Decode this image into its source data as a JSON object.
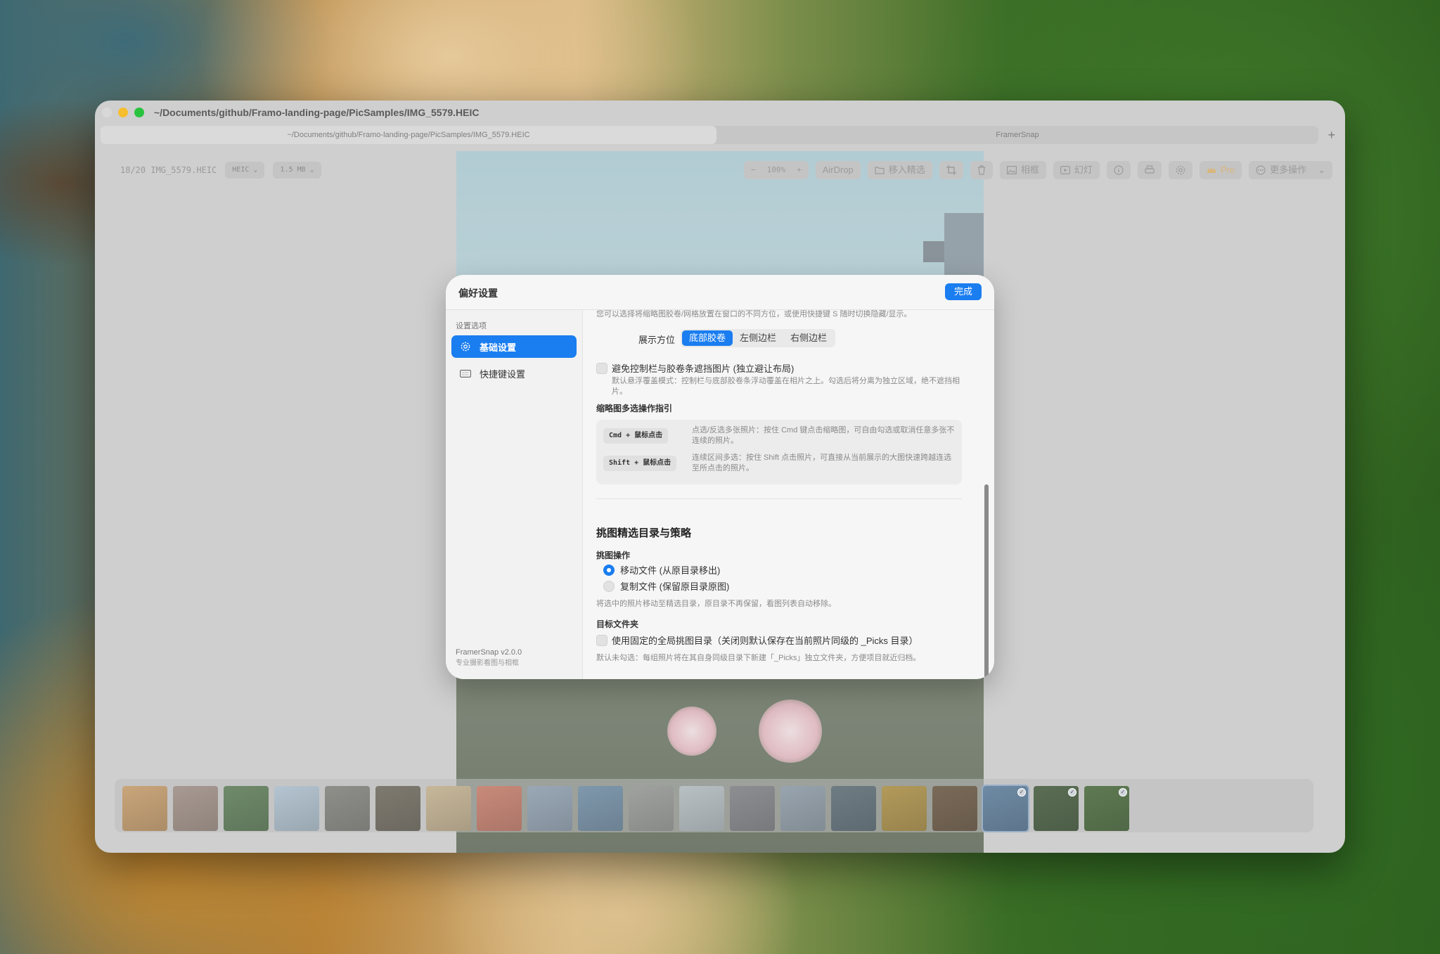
{
  "window": {
    "title": "~/Documents/github/Framo-landing-page/PicSamples/IMG_5579.HEIC",
    "tabs": [
      {
        "label": "~/Documents/github/Framo-landing-page/PicSamples/IMG_5579.HEIC",
        "active": true
      },
      {
        "label": "FramerSnap",
        "active": false
      }
    ],
    "new_tab_label": "+"
  },
  "toolbar": {
    "file_info": "18/20 IMG_5579.HEIC",
    "format": "HEIC",
    "file_size": "1.5 MB",
    "zoom_out": "−",
    "zoom_level": "100%",
    "zoom_in": "+",
    "airdrop": "AirDrop",
    "move_to_picks": "移入精选",
    "frame": "相框",
    "slideshow": "幻灯",
    "pro": "Pro",
    "more_actions": "更多操作"
  },
  "preferences": {
    "title": "偏好设置",
    "done_label": "完成",
    "sidebar": {
      "heading": "设置选项",
      "items": [
        {
          "label": "基础设置",
          "icon": "gear-icon",
          "active": true
        },
        {
          "label": "快捷键设置",
          "icon": "keyboard-icon",
          "active": false
        }
      ],
      "app_version": "FramerSnap v2.0.0",
      "app_tagline": "专业摄影看图与相框"
    },
    "content": {
      "intro": "您可以选择将缩略图胶卷/网格放置在窗口的不同方位，或使用快捷键 S 随时切换隐藏/显示。",
      "position_label": "展示方位",
      "position_options": [
        "底部胶卷",
        "左侧边栏",
        "右侧边栏"
      ],
      "position_selected": "底部胶卷",
      "avoid_overlap": {
        "label": "避免控制栏与胶卷条遮挡图片 (独立避让布局)",
        "checked": false,
        "description": "默认悬浮覆盖模式：控制栏与底部胶卷条浮动覆盖在相片之上。勾选后将分离为独立区域，绝不遮挡相片。"
      },
      "multi_select_heading": "缩略图多选操作指引",
      "shortcuts": [
        {
          "keys": "Cmd + 鼠标点击",
          "description": "点选/反选多张照片：按住 Cmd 键点击缩略图，可自由勾选或取消任意多张不连续的照片。"
        },
        {
          "keys": "Shift + 鼠标点击",
          "description": "连续区间多选：按住 Shift 点击照片，可直接从当前展示的大图快速跨越连选至所点击的照片。"
        }
      ],
      "picks_section_title": "挑图精选目录与策略",
      "pick_action_label": "挑图操作",
      "pick_actions": [
        {
          "label": "移动文件 (从原目录移出)",
          "selected": true
        },
        {
          "label": "复制文件 (保留原目录原图)",
          "selected": false
        }
      ],
      "pick_action_note": "将选中的照片移动至精选目录，原目录不再保留，看图列表自动移除。",
      "target_folder_label": "目标文件夹",
      "global_folder": {
        "label": "使用固定的全局挑图目录（关闭则默认保存在当前照片同级的 _Picks 目录）",
        "checked": false
      },
      "global_folder_note": "默认未勾选：每组照片将在其自身同级目录下新建「_Picks」独立文件夹，方便项目就近归档。"
    }
  },
  "filmstrip": {
    "count": 20,
    "thumb_colors": [
      "#c9a57a",
      "#a89a92",
      "#6f8a6a",
      "#b4c4d0",
      "#8f8f8a",
      "#7e7a70",
      "#c7b79a",
      "#c98a7a",
      "#9aa8b6",
      "#7f98ac",
      "#a0a2a0",
      "#b8c0c4",
      "#8c8e92",
      "#98a4ae",
      "#6e7c84",
      "#b29a5a",
      "#7a6a58",
      "#6e8aa4",
      "#5a6e54",
      "#5e7a52"
    ],
    "checked": [
      17,
      18,
      19
    ],
    "current": 17
  },
  "colors": {
    "accent": "#1a7df0",
    "pro": "#d8b57b"
  }
}
